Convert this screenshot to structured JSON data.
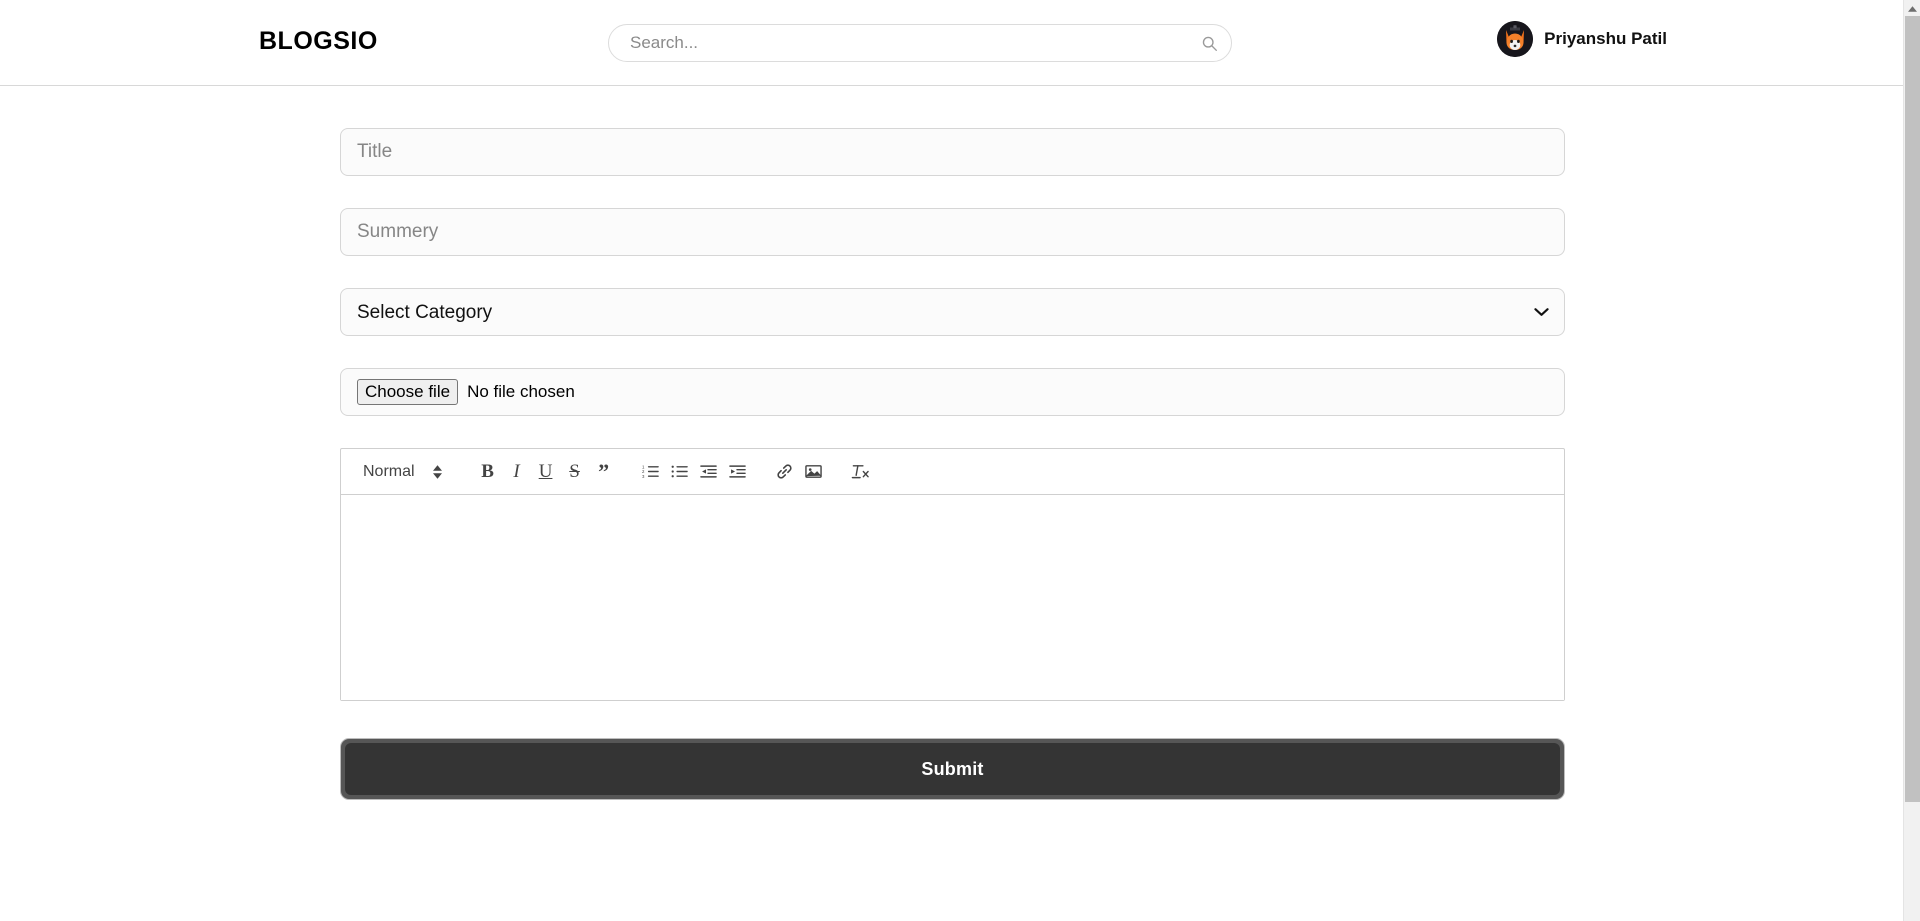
{
  "header": {
    "brand": "BLOGSIO",
    "search": {
      "placeholder": "Search...",
      "value": "",
      "icon": "search-icon"
    },
    "profile": {
      "name": "Priyanshu Patil",
      "avatar_icon": "fox-avatar",
      "avatar_bg": "#17161c",
      "avatar_fur": "#f0701a"
    }
  },
  "form": {
    "title_field": {
      "placeholder": "Title",
      "value": ""
    },
    "summary_field": {
      "placeholder": "Summery",
      "value": ""
    },
    "category_select": {
      "selected": "Select Category",
      "options": [
        "Select Category"
      ],
      "icon": "chevron-down-icon"
    },
    "file_input": {
      "button_label": "Choose file",
      "status": "No file chosen"
    },
    "editor": {
      "format_picker": {
        "label": "Normal",
        "icon": "up-down-arrows-icon"
      },
      "tools": [
        {
          "name": "bold-icon",
          "label": "B"
        },
        {
          "name": "italic-icon",
          "label": "I"
        },
        {
          "name": "underline-icon",
          "label": "U"
        },
        {
          "name": "strike-icon",
          "label": "S"
        },
        {
          "name": "blockquote-icon",
          "label": "”"
        },
        {
          "name": "ordered-list-icon",
          "label": ""
        },
        {
          "name": "bullet-list-icon",
          "label": ""
        },
        {
          "name": "outdent-icon",
          "label": ""
        },
        {
          "name": "indent-icon",
          "label": ""
        },
        {
          "name": "link-icon",
          "label": ""
        },
        {
          "name": "image-icon",
          "label": ""
        },
        {
          "name": "clear-format-icon",
          "label": ""
        }
      ],
      "body_text": ""
    },
    "submit_button": {
      "label": "Submit",
      "bg": "#343434",
      "text_color": "#ffffff"
    }
  },
  "scrollbar": {
    "orientation": "vertical",
    "thumb_color": "#c1c1c1",
    "track_color": "#f1f1f1"
  }
}
